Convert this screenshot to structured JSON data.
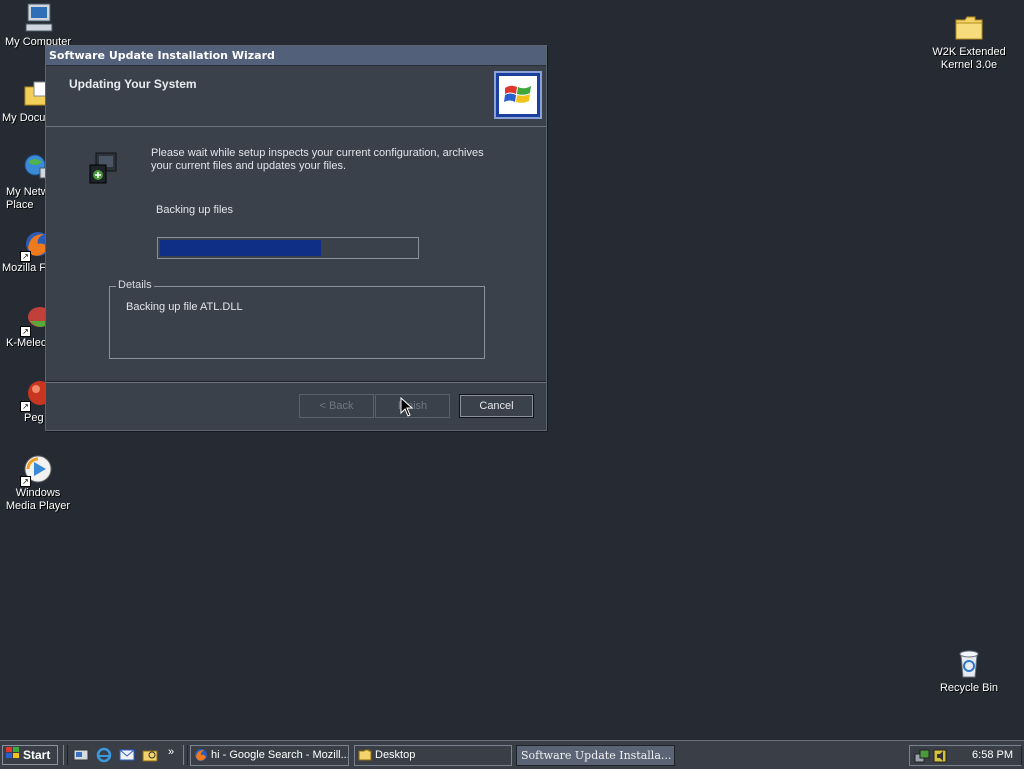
{
  "desktop": {
    "icons_left": [
      {
        "label": "My Computer",
        "icon": "computer-icon"
      },
      {
        "label": "My Docu",
        "icon": "documents-folder-icon"
      },
      {
        "label": "My Netw Place",
        "icon": "network-places-icon"
      },
      {
        "label": "Mozilla Fi",
        "icon": "firefox-icon"
      },
      {
        "label": "K-Melec",
        "icon": "k-meleon-icon"
      },
      {
        "label": "Peg",
        "icon": "pegasus-icon"
      },
      {
        "label": "Windows Media Player",
        "icon": "media-player-icon"
      }
    ],
    "icons_right": [
      {
        "label": "W2K Extended Kernel 3.0e",
        "icon": "folder-icon"
      },
      {
        "label": "Recycle Bin",
        "icon": "recycle-bin-icon"
      }
    ]
  },
  "dialog": {
    "title": "Software Update Installation Wizard",
    "header_title": "Updating Your System",
    "description": "Please wait while setup inspects your current configuration, archives your current files and updates your files.",
    "status": "Backing up files",
    "progress_fraction": 0.63,
    "details_label": "Details",
    "details_text": "Backing up file ATL.DLL",
    "buttons": {
      "back": "< Back",
      "finish": "Finish",
      "cancel": "Cancel"
    },
    "colors": {
      "progress_fill": "#0f2f86",
      "title_bar": "#52607a"
    }
  },
  "taskbar": {
    "start_label": "Start",
    "quick_launch": [
      "show-desktop-icon",
      "ie-icon",
      "outlook-icon",
      "explorer-icon"
    ],
    "chevron": "»",
    "tasks": [
      {
        "label": "hi - Google Search - Mozill...",
        "icon": "firefox-icon",
        "active": false
      },
      {
        "label": "Desktop",
        "icon": "folder-icon",
        "active": false
      },
      {
        "label": "Software Update Installa...",
        "icon": "",
        "active": true
      }
    ],
    "clock": "6:58 PM"
  }
}
